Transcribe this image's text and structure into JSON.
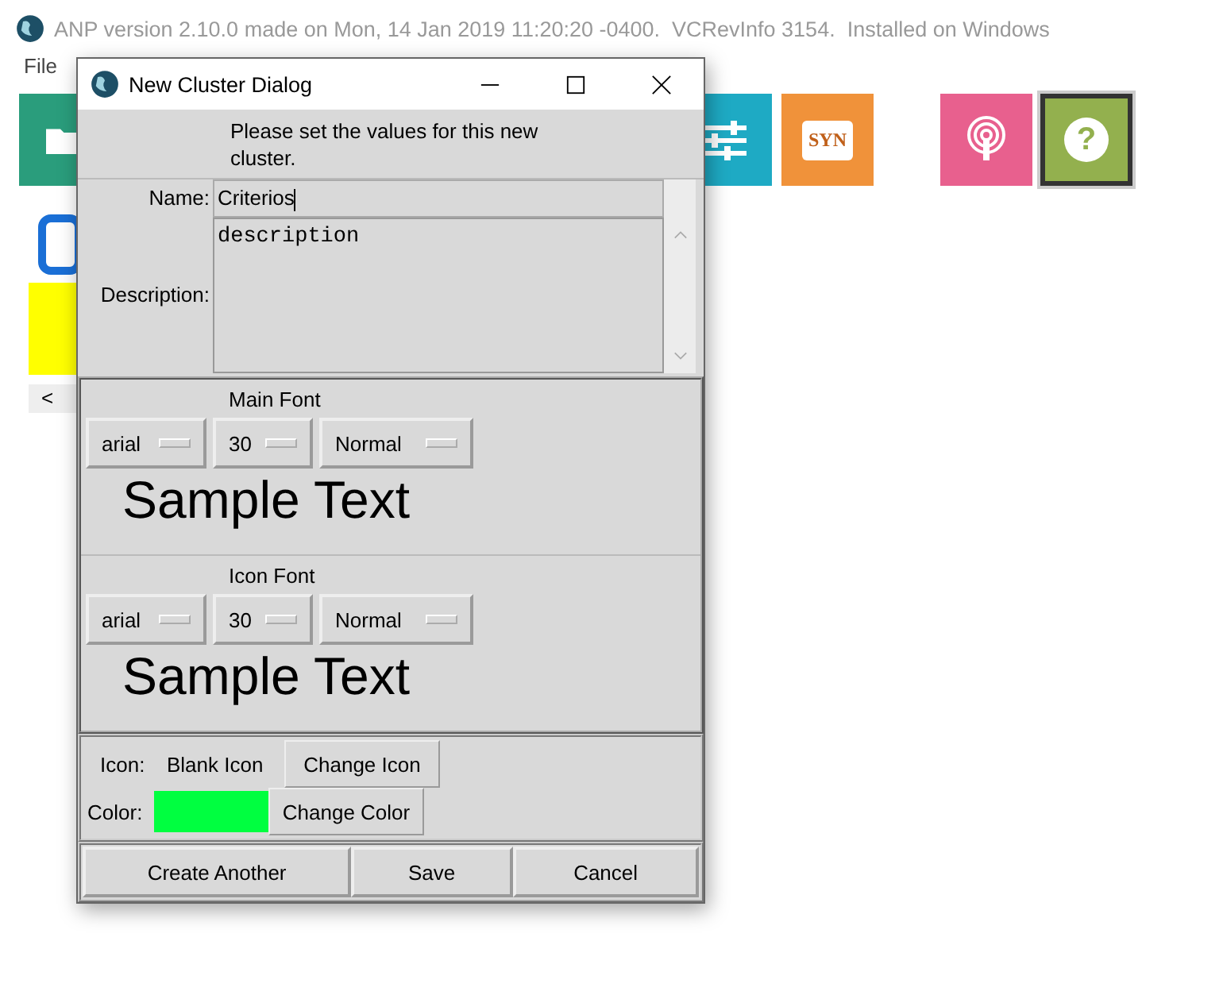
{
  "app": {
    "title": "ANP version 2.10.0 made on Mon, 14 Jan 2019 11:20:20 -0400.  VCRevInfo 3154.  Installed on Windows",
    "menu": [
      {
        "label": "File"
      }
    ],
    "toolbar": [
      {
        "kind": "folder",
        "color": "#2a9d7c",
        "selected": false
      },
      {
        "kind": "sliders",
        "color": "#1eaac4",
        "selected": false
      },
      {
        "kind": "syn",
        "label": "SYN",
        "color": "#f0923a",
        "selected": false
      },
      {
        "kind": "podcast",
        "color": "#e8608e",
        "selected": false
      },
      {
        "kind": "help",
        "label": "?",
        "color": "#93b04e",
        "selected": true
      }
    ],
    "scroll_left": "<"
  },
  "dialog": {
    "title": "New Cluster Dialog",
    "message": "Please set the values for this new cluster.",
    "name_label": "Name:",
    "name_value": "Criterios",
    "description_label": "Description:",
    "description_value": "description",
    "fonts": [
      {
        "title": "Main Font",
        "family": "arial",
        "size": "30",
        "style": "Normal",
        "sample": "Sample Text"
      },
      {
        "title": "Icon Font",
        "family": "arial",
        "size": "30",
        "style": "Normal",
        "sample": "Sample Text"
      }
    ],
    "icon_label": "Icon:",
    "icon_value": "Blank Icon",
    "change_icon": "Change Icon",
    "color_label": "Color:",
    "color": "#00ff40",
    "change_color": "Change Color",
    "buttons": [
      "Create Another",
      "Save",
      "Cancel"
    ]
  }
}
